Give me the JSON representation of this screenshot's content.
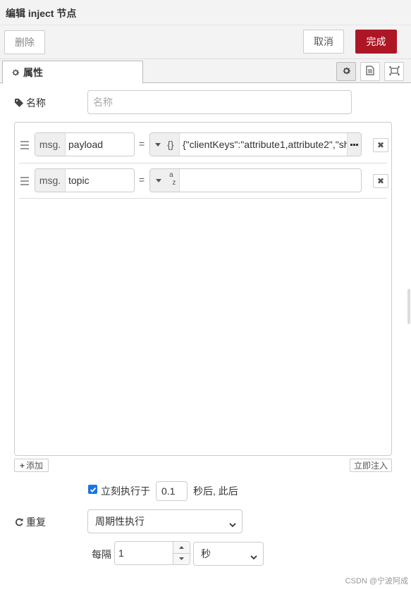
{
  "title": "编辑 inject 节点",
  "toolbar": {
    "delete_label": "删除",
    "cancel_label": "取消",
    "done_label": "完成"
  },
  "tabs": {
    "properties_label": "属性"
  },
  "name": {
    "label": "名称",
    "placeholder": "名称"
  },
  "properties": [
    {
      "prefix": "msg.",
      "key": "payload",
      "type_icon": "json-braces-icon",
      "type_symbol": "{}",
      "value": "{\"clientKeys\":\"attribute1,attribute2\",\"sh"
    },
    {
      "prefix": "msg.",
      "key": "topic",
      "type_icon": "string-az-icon",
      "type_symbol": "a",
      "type_symbol_sub": "z",
      "value": ""
    }
  ],
  "equals": "=",
  "list_buttons": {
    "add_label": "添加",
    "inject_now_label": "立即注入"
  },
  "once": {
    "checked": true,
    "label": "立刻执行于",
    "delay_value": "0.1",
    "suffix": "秒后, 此后"
  },
  "repeat": {
    "label": "重复",
    "selected": "周期性执行"
  },
  "interval": {
    "label": "每隔",
    "value": "1",
    "unit": "秒"
  },
  "watermark": "CSDN @宁波阿成",
  "colors": {
    "primary": "#ad1625",
    "checkbox": "#1a73e8"
  }
}
